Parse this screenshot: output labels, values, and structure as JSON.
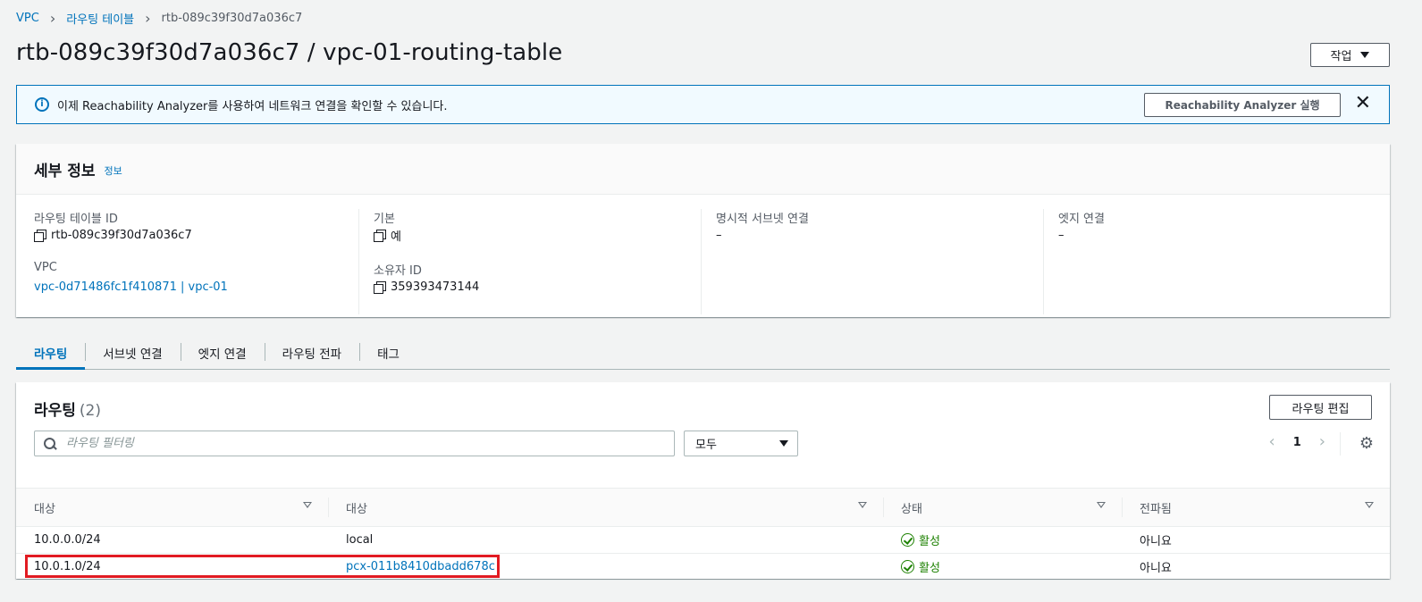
{
  "breadcrumb": {
    "vpc": "VPC",
    "route_tables": "라우팅 테이블",
    "current": "rtb-089c39f30d7a036c7"
  },
  "page": {
    "title": "rtb-089c39f30d7a036c7 / vpc-01-routing-table",
    "actions_label": "작업"
  },
  "banner": {
    "message": "이제 Reachability Analyzer를 사용하여 네트워크 연결을 확인할 수 있습니다.",
    "button_label": "Reachability Analyzer 실행",
    "close_glyph": "✕"
  },
  "details": {
    "heading": "세부 정보",
    "info_link": "정보",
    "route_table_id_label": "라우팅 테이블 ID",
    "route_table_id_value": "rtb-089c39f30d7a036c7",
    "vpc_label": "VPC",
    "vpc_value": "vpc-0d71486fc1f410871 | vpc-01",
    "main_label": "기본",
    "main_value": "예",
    "owner_label": "소유자 ID",
    "owner_value": "359393473144",
    "subnet_assoc_label": "명시적 서브넷 연결",
    "subnet_assoc_value": "–",
    "edge_assoc_label": "엣지 연결",
    "edge_assoc_value": "–"
  },
  "tabs": [
    "라우팅",
    "서브넷 연결",
    "엣지 연결",
    "라우팅 전파",
    "태그"
  ],
  "routes": {
    "title": "라우팅",
    "count": "(2)",
    "edit_label": "라우팅 편집",
    "filter_placeholder": "라우팅 필터링",
    "select_value": "모두",
    "page_number": "1",
    "columns": [
      "대상",
      "대상",
      "상태",
      "전파됨"
    ],
    "rows": [
      {
        "destination": "10.0.0.0/24",
        "target": "local",
        "status": "활성",
        "propagated": "아니요"
      },
      {
        "destination": "10.0.1.0/24",
        "target": "pcx-011b8410dbadd678c",
        "status": "활성",
        "propagated": "아니요"
      }
    ]
  },
  "colors": {
    "link": "#0073bb",
    "success": "#1d8102",
    "highlight": "#e11b22"
  }
}
